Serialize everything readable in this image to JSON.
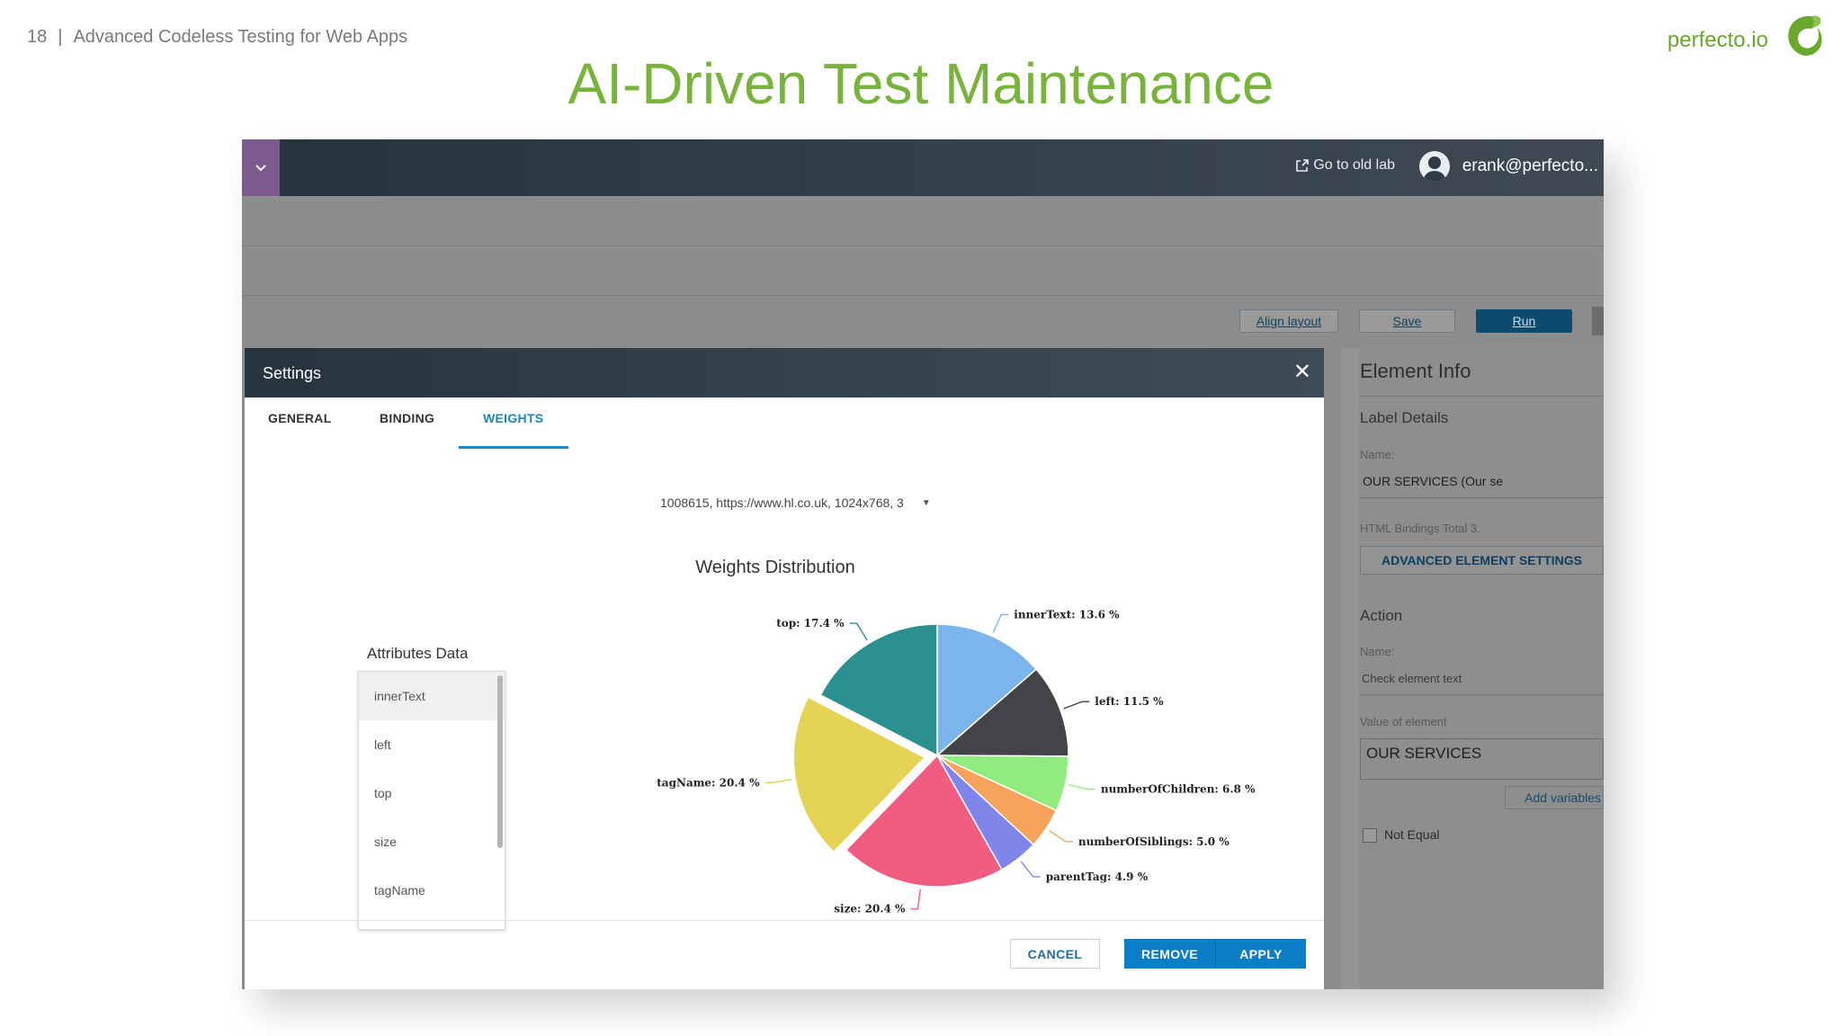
{
  "slide": {
    "page_number": "18",
    "separator": "|",
    "deck_title": "Advanced Codeless Testing for Web Apps",
    "title": "AI-Driven Test Maintenance",
    "brand": "perfecto.io"
  },
  "app": {
    "topbar": {
      "old_lab": "Go to old lab",
      "user": "erank@perfecto..."
    },
    "toolbar": {
      "align_layout": "Align layout",
      "save": "Save",
      "run": "Run"
    },
    "element_info": {
      "title": "Element Info",
      "label_details": "Label Details",
      "name_label": "Name:",
      "name_value": "OUR SERVICES (Our se",
      "html_bindings": "HTML Bindings Total 3.",
      "advanced_button": "ADVANCED ELEMENT SETTINGS",
      "action_title": "Action",
      "action_name_label": "Name:",
      "action_name_value": "Check element text",
      "value_label": "Value of element",
      "value_text": "OUR SERVICES",
      "add_variables": "Add variables",
      "not_equal": "Not Equal"
    }
  },
  "dialog": {
    "title": "Settings",
    "tabs": [
      {
        "label": "GENERAL",
        "active": false
      },
      {
        "label": "BINDING",
        "active": false
      },
      {
        "label": "WEIGHTS",
        "active": true
      }
    ],
    "selector": "1008615, https://www.hl.co.uk, 1024x768, 3",
    "attributes_title": "Attributes Data",
    "attributes": [
      "innerText",
      "left",
      "top",
      "size",
      "tagName"
    ],
    "buttons": {
      "cancel": "CANCEL",
      "remove": "REMOVE",
      "apply": "APPLY"
    }
  },
  "chart_data": {
    "type": "pie",
    "title": "Weights Distribution",
    "slices": [
      {
        "name": "innerText",
        "value": 13.6,
        "label": "innerText: 13.6 %",
        "color": "#7cb5ec"
      },
      {
        "name": "left",
        "value": 11.5,
        "label": "left: 11.5 %",
        "color": "#434348"
      },
      {
        "name": "numberOfChildren",
        "value": 6.8,
        "label": "numberOfChildren: 6.8 %",
        "color": "#90ed7d"
      },
      {
        "name": "numberOfSiblings",
        "value": 5.0,
        "label": "numberOfSiblings: 5.0 %",
        "color": "#f7a35c"
      },
      {
        "name": "parentTag",
        "value": 4.9,
        "label": "parentTag: 4.9 %",
        "color": "#8085e9"
      },
      {
        "name": "size",
        "value": 20.4,
        "label": "size: 20.4 %",
        "color": "#f15c80"
      },
      {
        "name": "tagName",
        "value": 20.4,
        "label": "tagName: 20.4 %",
        "color": "#e4d354",
        "sliced": true
      },
      {
        "name": "top",
        "value": 17.4,
        "label": "top: 17.4 %",
        "color": "#2b908f"
      }
    ]
  }
}
